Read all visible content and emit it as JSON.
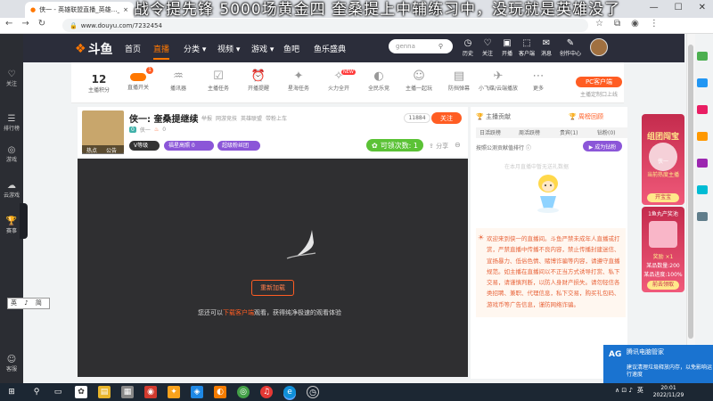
{
  "browser": {
    "tab_title": "侠一 - 英雄联盟直播_英雄…_斗鱼",
    "tab_close": "×",
    "new_tab": "+",
    "url": "www.douyu.com/7232454",
    "min": "—",
    "max": "☐",
    "close": "✕"
  },
  "overlay_text": "战令提先锋 5000场黄金四 奎桑提上中辅练习中，没玩就是英雄没了",
  "os_sidebar": {
    "items": [
      {
        "label": "关注",
        "icon": "♡"
      },
      {
        "label": "排行榜",
        "icon": "☰"
      },
      {
        "label": "游戏",
        "icon": "◎"
      },
      {
        "label": "云游戏",
        "icon": "☁"
      },
      {
        "label": "赛事",
        "icon": "🏆"
      },
      {
        "label": "客服",
        "icon": "☺"
      }
    ],
    "jian_box": "英 ♪ 简"
  },
  "header": {
    "logo": "斗鱼",
    "nav": [
      "首页",
      "直播",
      "分类 ▾",
      "视频 ▾",
      "游戏 ▾",
      "鱼吧",
      "鱼乐盛典"
    ],
    "search_placeholder": "genna",
    "icons": [
      {
        "label": "历史",
        "glyph": "◷"
      },
      {
        "label": "关注",
        "glyph": "♡"
      },
      {
        "label": "开播",
        "glyph": "▣"
      },
      {
        "label": "客户端",
        "glyph": "⬚"
      },
      {
        "label": "消息",
        "glyph": "✉"
      },
      {
        "label": "创作中心",
        "glyph": "✎"
      }
    ]
  },
  "toolbar": {
    "level": "12",
    "level_label": "主播积分",
    "items": [
      {
        "label": "直播开关",
        "glyph": "●"
      },
      {
        "label": "播讯器",
        "glyph": "♒"
      },
      {
        "label": "主播任务",
        "glyph": "☑"
      },
      {
        "label": "开播提醒",
        "glyph": "⏰"
      },
      {
        "label": "星海任务",
        "glyph": "✦"
      },
      {
        "label": "火力全开",
        "glyph": "✧"
      },
      {
        "label": "全民乐竞",
        "glyph": "◐"
      },
      {
        "label": "主播一起玩",
        "glyph": "☺"
      },
      {
        "label": "防挡弹幕",
        "glyph": "▤"
      },
      {
        "label": "小飞碟/云端播放",
        "glyph": "✈"
      },
      {
        "label": "更多",
        "glyph": "⋯"
      }
    ],
    "kb_badge": "1",
    "new_badge": "NEW",
    "pc_btn": "PC客户端",
    "pc_sub": "主播定制口上线"
  },
  "room": {
    "title": "侠一:  奎桑提继续",
    "tags": [
      "举报",
      "网游竞技",
      "英雄联盟",
      "带粉上车"
    ],
    "line2_name": "侠一",
    "line2_badge": "0",
    "heat": "0",
    "thumb_tag1": "热点",
    "thumb_tag2": "公告",
    "fol_count": "11884",
    "follow": "关注",
    "pills": [
      {
        "text": "V等级",
        "color": "#333"
      },
      {
        "text": "福星高照  0",
        "color": "#8b56d8"
      },
      {
        "text": "超级粉丝团",
        "color": "#8b56d8"
      }
    ],
    "vote": "可领次数:  1",
    "share": "⇪ 分享",
    "more": "⊖"
  },
  "video": {
    "button": "重新加载",
    "text_pre": "您还可以",
    "text_hl": "下载客户端",
    "text_post": "观看，获得纯净极速的观看体验"
  },
  "right_panel": {
    "tab_rank": "🏆 主播贡献",
    "tab_weekly": "🏆 周榜回顾",
    "subtabs": [
      "日活跃榜",
      "周活跃榜",
      "贵宾(1)",
      "钻粉(0)"
    ],
    "info": "按照公测贡献值排行 ⓘ",
    "effect_btn": "▶ 成为钻粉",
    "empty": "在本月直播中暂无送礼数据",
    "notice_icon": "☀",
    "notice": "欢迎来到侠一的直播间。斗鱼严禁未成年人直播或打赏，严禁直播中传播不良内容，禁止传播封建迷信、宣扬暴力、低俗色情、赌博诈骗等内容，请遵守直播规范。如主播在直播间以不正当方式诱导打赏、私下交易，请谨慎判断，以防人身财产损失。请勿轻信各类招聘、兼职、代理信息，私下交易，购买礼包码、游戏币等广告信息，谨防网络诈骗。"
  },
  "widget1": {
    "title": "组团闯宝",
    "name": "侠一",
    "line": "当前热度主播",
    "button": "开宝宝"
  },
  "widget2": {
    "title": "1鱼丸产奖池",
    "line1": "奖励 ×1",
    "line2": "某品数量:200",
    "line3": "某品进度:100%",
    "button": "前去领取"
  },
  "popup": {
    "logo": "AG",
    "title": "腾讯电脑管家",
    "body": "建议清理垃圾释放内存，以免影响运行速度"
  },
  "taskbar": {
    "time": "20:01",
    "date": "2022/11/29",
    "lang": "英",
    "tray_icons": "∧ ⊡ ♪"
  },
  "colors": {
    "accent": "#ff5d23",
    "header": "#2b2d3a",
    "video_bg": "#2f2f31"
  }
}
